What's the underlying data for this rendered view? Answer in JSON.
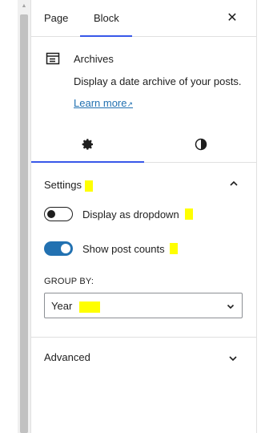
{
  "tabs": {
    "page_label": "Page",
    "block_label": "Block"
  },
  "close_icon": "close-icon",
  "block": {
    "icon": "archive-icon",
    "title": "Archives",
    "description": "Display a date archive of your posts.",
    "learn_more": "Learn more"
  },
  "sub_tabs": [
    {
      "name": "settings",
      "icon": "gear-icon",
      "active": true
    },
    {
      "name": "styles",
      "icon": "contrast-icon",
      "active": false
    }
  ],
  "settings": {
    "title": "Settings",
    "toggles": [
      {
        "label": "Display as dropdown",
        "on": false
      },
      {
        "label": "Show post counts",
        "on": true
      }
    ],
    "group_by_label": "GROUP BY:",
    "group_by_value": "Year"
  },
  "advanced": {
    "title": "Advanced"
  },
  "colors": {
    "accent": "#3858e9",
    "toggle_on": "#2271b1",
    "link": "#2271b1",
    "highlight": "#ffff00"
  }
}
